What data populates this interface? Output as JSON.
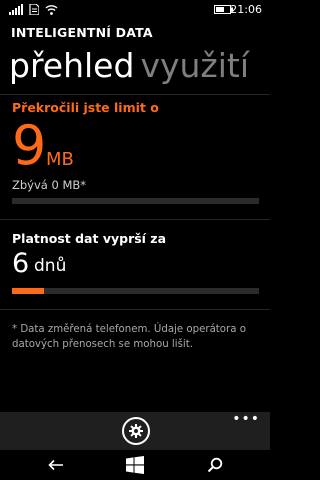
{
  "status_bar": {
    "time": "21:06",
    "icons": [
      "signal-icon",
      "sim-icon",
      "wifi-icon",
      "battery-icon"
    ]
  },
  "app": {
    "title": "INTELIGENTNÍ DATA"
  },
  "pivot": {
    "active": "přehled",
    "inactive": "využití"
  },
  "limit": {
    "title": "Překročili jste limit o",
    "value": "9",
    "unit": "MB",
    "remaining": "Zbývá 0 MB*",
    "usage_fraction": 0
  },
  "validity": {
    "title": "Platnost dat vyprší za",
    "value": "6",
    "unit": "dnů",
    "progress_fraction": 0.13
  },
  "note": "* Data změřená telefonem. Údaje operátora o datových přenosech se mohou lišit.",
  "app_bar": {
    "more_label": "•••",
    "icons": [
      "settings-icon"
    ]
  },
  "nav_bar": {
    "icons": [
      "back-arrow-icon",
      "windows-start-icon",
      "search-icon"
    ]
  },
  "colors": {
    "accent": "#ff6a1a",
    "background": "#000000",
    "app_bar": "#1f1f1f",
    "inactive_text": "#7f7f7f"
  }
}
